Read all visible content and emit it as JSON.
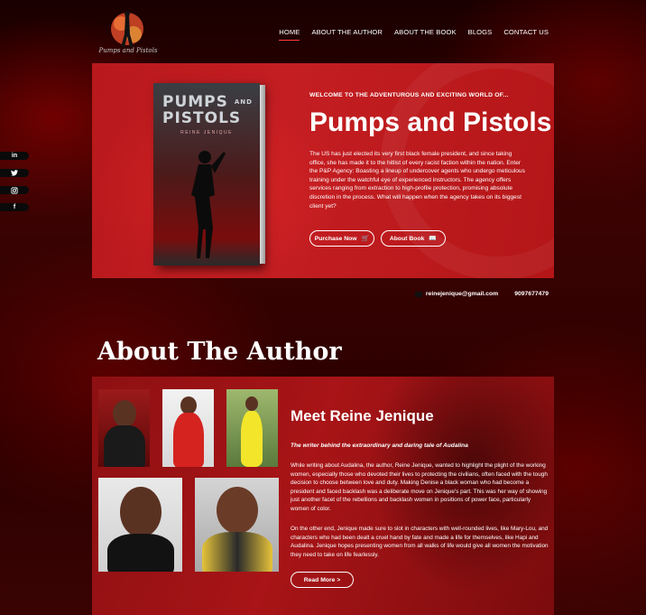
{
  "header": {
    "logo_text": "Pumps and Pistols",
    "nav": [
      {
        "label": "HOME",
        "active": true
      },
      {
        "label": "ABOUT THE AUTHOR",
        "active": false
      },
      {
        "label": "ABOUT THE BOOK",
        "active": false
      },
      {
        "label": "BLOGS",
        "active": false
      },
      {
        "label": "CONTACT US",
        "active": false
      }
    ]
  },
  "social": [
    {
      "icon": "linkedin-icon",
      "glyph": "in"
    },
    {
      "icon": "twitter-icon",
      "glyph": "🐦"
    },
    {
      "icon": "instagram-icon",
      "glyph": "◎"
    },
    {
      "icon": "facebook-icon",
      "glyph": "f"
    }
  ],
  "hero": {
    "book_title_line1": "PUMPS",
    "book_title_and": "AND",
    "book_title_line2": "PISTOLS",
    "book_author": "REINE JENIQUE",
    "eyebrow": "WELCOME TO THE ADVENTUROUS AND EXCITING WORLD OF...",
    "title": "Pumps and Pistols",
    "description": "The US has just elected its very first black female president, and since taking office, she has made it to the hitlist of every racist faction within the nation. Enter the P&P Agency: Boasting a lineup of undercover agents who undergo meticulous training under the watchful eye of experienced instructors. The agency offers services ranging from extraction to high-profile protection, promising absolute discretion in the process. What will happen when the agency takes on its biggest client yet?",
    "purchase_label": "Purchase Now",
    "about_book_label": "About Book"
  },
  "contact": {
    "email": "reinejenique@gmail.com",
    "phone": "9097677479"
  },
  "about": {
    "heading": "About The Author",
    "name": "Meet Reine Jenique",
    "tagline": "The writer behind the extraordinary and daring tale of Audalina",
    "para1": "While writing about Audalina, the author, Reine Jenique, wanted to highlight the plight of the working women, especially those who devoted their lives to protecting the civilians, often faced with the tough decision to choose between love and duty. Making Denise a black woman who had become a president and faced backlash was a deliberate move on Jenique's part. This was her way of showing just another facet of the rebellions and backlash women in positions of power face, particularly women of color.",
    "para2": "On the other end, Jenique made sure to slot in characters with well-rounded lives, like Mary-Lou, and characters who had been dealt a cruel hand by fate and made a life for themselves, like Hapi and Audalina. Jenique hopes presenting women from all walks of life would give all women the motivation they need to take on life fearlessly.",
    "read_more_label": "Read More >"
  },
  "colors": {
    "accent": "#c41e22",
    "nav_underline": "#ff3b3b"
  }
}
